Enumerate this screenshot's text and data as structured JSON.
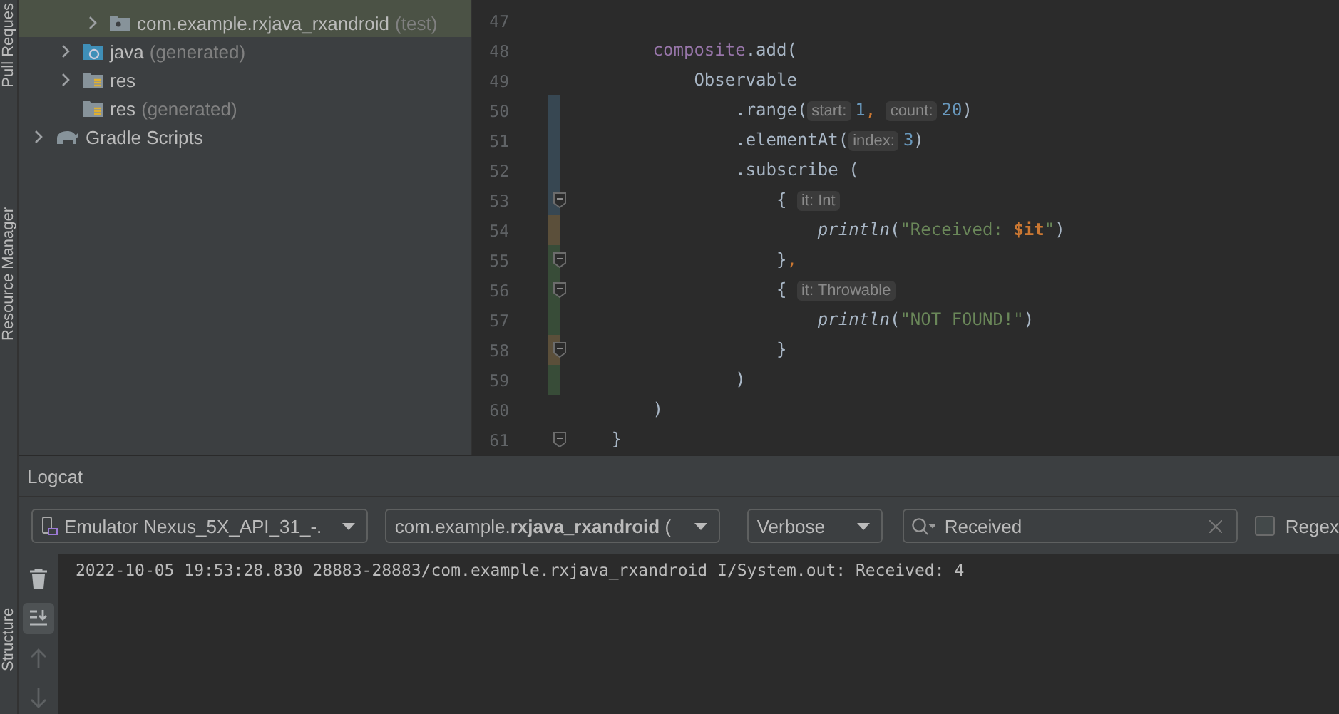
{
  "side_stripe": {
    "labels": [
      "Pull Reques",
      "Resource Manager",
      "Structure"
    ]
  },
  "project_tree": [
    {
      "children": [
        {
          "children": [
            {
              "label": "com.example.rxjava_rxandroid",
              "suffix": "(test)",
              "kind": "package",
              "expanded": false,
              "selected": true
            }
          ]
        },
        {
          "label": "java",
          "suffix": "(generated)",
          "kind": "java-folder",
          "expanded": false,
          "selected": false
        },
        {
          "label": "res",
          "kind": "res-folder",
          "expanded": false,
          "selected": false
        },
        {
          "label": "res",
          "suffix": "(generated)",
          "kind": "res-folder",
          "selected": false
        }
      ]
    },
    {
      "label": "Gradle Scripts",
      "kind": "gradle",
      "expanded": false,
      "selected": false
    }
  ],
  "editor": {
    "lines": [
      {
        "number": "47"
      },
      {
        "children": [
          {
            "children": [
              {
                "number": "48",
                "tokens": [
                  {
                    "kind": "field",
                    "text": "composite"
                  },
                  {
                    "kind": "plain",
                    "text": ".add("
                  }
                ],
                "children": [
                  {
                    "number": "49",
                    "tokens": [
                      {
                        "kind": "plain",
                        "text": "Observable"
                      }
                    ],
                    "children": [
                      {
                        "number": "50",
                        "color": "#374752",
                        "tokens": [
                          {
                            "kind": "plain",
                            "text": ".range("
                          },
                          {
                            "kind": "hint",
                            "text": "start:"
                          },
                          {
                            "kind": "number",
                            "text": "1"
                          },
                          {
                            "kind": "punct",
                            "text": ", "
                          },
                          {
                            "kind": "hint",
                            "text": "count:"
                          },
                          {
                            "kind": "number",
                            "text": "20"
                          },
                          {
                            "kind": "plain",
                            "text": ")"
                          }
                        ]
                      },
                      {
                        "number": "51",
                        "color": "#374752",
                        "tokens": [
                          {
                            "kind": "plain",
                            "text": ".elementAt("
                          },
                          {
                            "kind": "hint",
                            "text": "index:"
                          },
                          {
                            "kind": "number",
                            "text": "3"
                          },
                          {
                            "kind": "plain",
                            "text": ")"
                          }
                        ]
                      },
                      {
                        "number": "52",
                        "color": "#374752",
                        "tokens": [
                          {
                            "kind": "plain",
                            "text": ".subscribe ("
                          }
                        ],
                        "children": [
                          {
                            "number": "53",
                            "color": "#374752",
                            "fold": true,
                            "tokens": [
                              {
                                "kind": "plain",
                                "text": "{ "
                              },
                              {
                                "kind": "hint",
                                "text": "it: Int"
                              }
                            ],
                            "children": [
                              {
                                "number": "54",
                                "color": "#5b4f3a",
                                "tokens": [
                                  {
                                    "kind": "fn",
                                    "text": "println"
                                  },
                                  {
                                    "kind": "plain",
                                    "text": "("
                                  },
                                  {
                                    "kind": "string",
                                    "text": "\"Received: "
                                  },
                                  {
                                    "kind": "template",
                                    "text": "$it"
                                  },
                                  {
                                    "kind": "string",
                                    "text": "\""
                                  },
                                  {
                                    "kind": "plain",
                                    "text": ")"
                                  }
                                ]
                              }
                            ]
                          },
                          {
                            "number": "55",
                            "color": "#384c38",
                            "fold": true,
                            "tokens": [
                              {
                                "kind": "plain",
                                "text": "}"
                              },
                              {
                                "kind": "punct",
                                "text": ","
                              }
                            ]
                          },
                          {
                            "number": "56",
                            "color": "#384c38",
                            "fold": true,
                            "tokens": [
                              {
                                "kind": "plain",
                                "text": "{ "
                              },
                              {
                                "kind": "hint",
                                "text": "it: Throwable"
                              }
                            ],
                            "children": [
                              {
                                "number": "57",
                                "color": "#384c38",
                                "tokens": [
                                  {
                                    "kind": "fn",
                                    "text": "println"
                                  },
                                  {
                                    "kind": "plain",
                                    "text": "("
                                  },
                                  {
                                    "kind": "string",
                                    "text": "\"NOT FOUND!\""
                                  },
                                  {
                                    "kind": "plain",
                                    "text": ")"
                                  }
                                ]
                              }
                            ]
                          },
                          {
                            "number": "58",
                            "color": "#5b4f3a",
                            "fold": true,
                            "tokens": [
                              {
                                "kind": "plain",
                                "text": "}"
                              }
                            ]
                          }
                        ]
                      },
                      {
                        "number": "59",
                        "color": "#384c38",
                        "tokens": [
                          {
                            "kind": "plain",
                            "text": ")"
                          }
                        ]
                      }
                    ]
                  }
                ]
              },
              {
                "number": "60",
                "tokens": [
                  {
                    "kind": "plain",
                    "text": ")"
                  }
                ]
              }
            ]
          },
          {
            "number": "61",
            "fold": true,
            "tokens": [
              {
                "kind": "plain",
                "text": "}"
              }
            ]
          }
        ]
      }
    ]
  },
  "logcat": {
    "title": "Logcat",
    "device": "Emulator Nexus_5X_API_31_-.",
    "package": "com.example.**rxjava_rxandroid** (",
    "level": "Verbose",
    "search": {
      "value": "Received"
    },
    "regex": {
      "label": "Regex",
      "checked": false
    },
    "tools": [
      {
        "kind": "trash",
        "selected": false,
        "disabled": false
      },
      {
        "kind": "scroll-end",
        "selected": true,
        "disabled": false
      },
      {
        "kind": "up",
        "selected": false,
        "disabled": true
      },
      {
        "kind": "down",
        "selected": false,
        "disabled": true
      }
    ],
    "lines": [
      "2022-10-05 19:53:28.830 28883-28883/com.example.rxjava_rxandroid I/System.out: Received: 4"
    ]
  }
}
